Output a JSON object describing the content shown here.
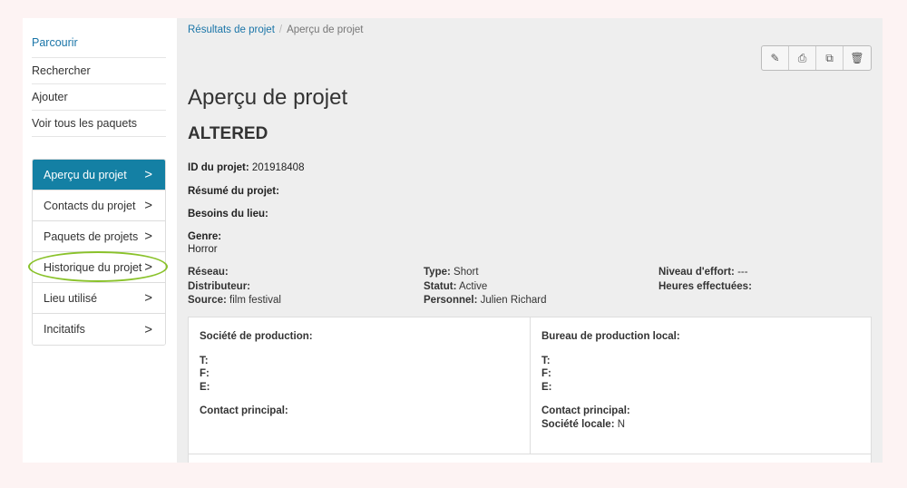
{
  "nav": {
    "browse": "Parcourir",
    "search": "Rechercher",
    "add": "Ajouter",
    "all_packages": "Voir tous les paquets"
  },
  "side_menu": {
    "items": [
      {
        "label": "Aperçu du projet",
        "active": true
      },
      {
        "label": "Contacts du projet",
        "active": false
      },
      {
        "label": "Paquets de projets",
        "active": false
      },
      {
        "label": "Historique du projet",
        "active": false
      },
      {
        "label": "Lieu utilisé",
        "active": false
      },
      {
        "label": "Incitatifs",
        "active": false
      }
    ],
    "chevron": ">"
  },
  "breadcrumb": {
    "parent": "Résultats de projet",
    "separator": "/",
    "current": "Aperçu de projet"
  },
  "toolbar": {
    "icons": [
      "pencil-icon",
      "printer-icon",
      "copy-icon",
      "trash-icon"
    ],
    "glyphs": [
      "✎",
      "⎙",
      "⧉",
      "🗑"
    ]
  },
  "page": {
    "title": "Aperçu de projet",
    "project_name": "ALTERED"
  },
  "details": {
    "id_label": "ID du projet:",
    "id_value": " 201918408",
    "summary_label": "Résumé du projet:",
    "needs_label": "Besoins du lieu:",
    "genre_label": "Genre:",
    "genre_value": "Horror"
  },
  "grid": {
    "network_label": "Réseau:",
    "network_value": "",
    "distributor_label": "Distributeur:",
    "distributor_value": "",
    "source_label": "Source:",
    "source_value": " film festival",
    "type_label": "Type:",
    "type_value": " Short",
    "status_label": "Statut:",
    "status_value": " Active",
    "staff_label": "Personnel:",
    "staff_value": " Julien Richard",
    "effort_label": "Niveau d'effort:",
    "effort_value": " ---",
    "hours_label": "Heures effectuées:",
    "hours_value": ""
  },
  "panel": {
    "left": {
      "title": "Société de production:",
      "t": "T:",
      "f": "F:",
      "e": "E:",
      "contact": "Contact principal:"
    },
    "right": {
      "title": "Bureau de production local:",
      "t": "T:",
      "f": "F:",
      "e": "E:",
      "contact": "Contact principal:",
      "local_label": "Société locale:",
      "local_value": " N"
    }
  }
}
